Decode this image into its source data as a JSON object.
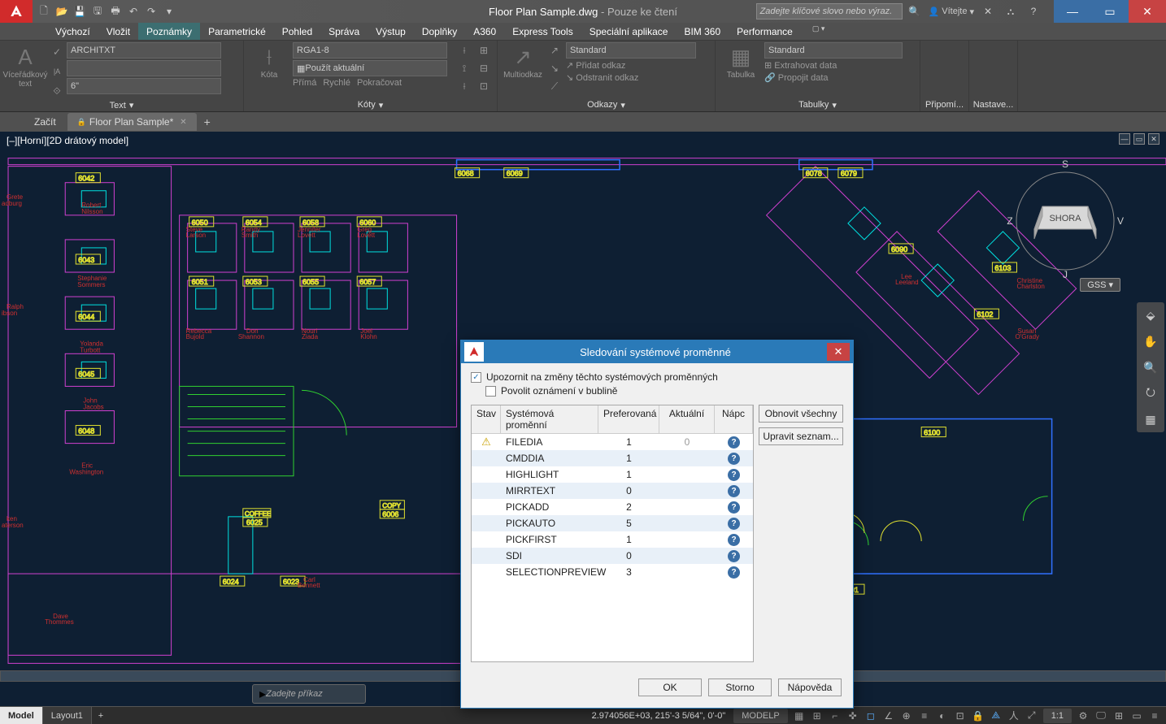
{
  "title": {
    "filename": "Floor Plan Sample.dwg",
    "suffix": " - Pouze ke čtení"
  },
  "search_placeholder": "Zadejte klíčové slovo nebo výraz.",
  "signin": "Vítejte",
  "ribbon_tabs": [
    "Výchozí",
    "Vložit",
    "Poznámky",
    "Parametrické",
    "Pohled",
    "Správa",
    "Výstup",
    "Doplňky",
    "A360",
    "Express Tools",
    "Speciální aplikace",
    "BIM 360",
    "Performance"
  ],
  "ribbon_active_tab": 2,
  "ribbon": {
    "text": {
      "big": "Víceřádkový text",
      "style": "ARCHITXT",
      "ht": "6\"",
      "group": "Text"
    },
    "dim": {
      "big": "Kóta",
      "style": "RGA1-8",
      "use": "Použít aktuální",
      "lin": "Přímá",
      "quick": "Rychlé",
      "cont": "Pokračovat",
      "group": "Kóty"
    },
    "leader": {
      "big": "Multiodkaz",
      "std": "Standard",
      "add": "Přidat odkaz",
      "rem": "Odstranit odkaz",
      "group": "Odkazy"
    },
    "table": {
      "big": "Tabulka",
      "std": "Standard",
      "ext": "Extrahovat data",
      "link": "Propojit data",
      "group": "Tabulky"
    },
    "extra": [
      "Připomí...",
      "Nastave..."
    ]
  },
  "doctabs": {
    "start": "Začít",
    "file": "Floor Plan Sample*"
  },
  "viewport_label": "[–][Horní][2D drátový model]",
  "viewcube": {
    "top": "SHORA",
    "n": "S",
    "e": "V",
    "w": "Z",
    "s": "J"
  },
  "gss": "GSS",
  "cmdline_placeholder": "Zadejte příkaz",
  "dialog": {
    "title": "Sledování systémové proměnné",
    "chk_notify": "Upozornit na změny těchto systémových proměnných",
    "chk_bubble": "Povolit oznámení v bublině",
    "head": {
      "stav": "Stav",
      "sys": "Systémová proměnní",
      "pref": "Preferovaná",
      "akt": "Aktuální",
      "nap": "Nápc"
    },
    "rows": [
      {
        "warn": true,
        "name": "FILEDIA",
        "pref": "1",
        "akt": "0"
      },
      {
        "name": "CMDDIA",
        "pref": "1",
        "akt": ""
      },
      {
        "name": "HIGHLIGHT",
        "pref": "1",
        "akt": ""
      },
      {
        "name": "MIRRTEXT",
        "pref": "0",
        "akt": ""
      },
      {
        "name": "PICKADD",
        "pref": "2",
        "akt": ""
      },
      {
        "name": "PICKAUTO",
        "pref": "5",
        "akt": ""
      },
      {
        "name": "PICKFIRST",
        "pref": "1",
        "akt": ""
      },
      {
        "name": "SDI",
        "pref": "0",
        "akt": ""
      },
      {
        "name": "SELECTIONPREVIEW",
        "pref": "3",
        "akt": ""
      }
    ],
    "restore": "Obnovit všechny",
    "edit": "Upravit seznam...",
    "ok": "OK",
    "cancel": "Storno",
    "help": "Nápověda"
  },
  "status": {
    "model": "Model",
    "layout": "Layout1",
    "coords": "2.974056E+03, 215'-3 5/64\", 0'-0\"",
    "modelp": "MODELP",
    "scale": "1:1"
  }
}
